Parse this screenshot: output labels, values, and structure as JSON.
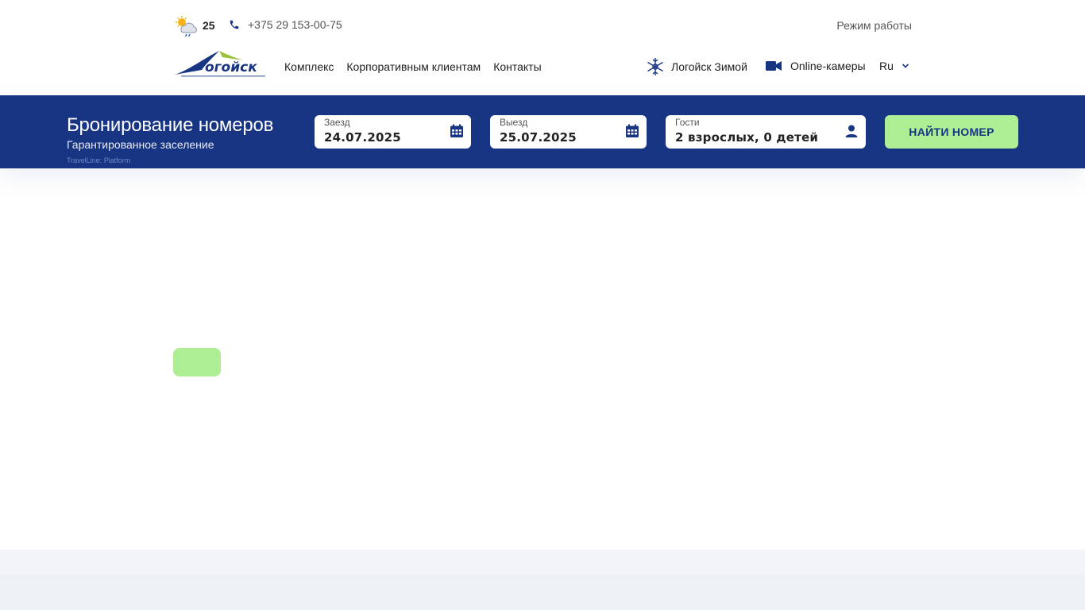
{
  "header": {
    "temperature": "25",
    "weather_icon": "partly-cloudy-rain-icon",
    "phone": "+375 29 153-00-75",
    "hours_link": "Режим работы",
    "nav": [
      {
        "label": "Комплекс"
      },
      {
        "label": "Корпоративным клиентам"
      },
      {
        "label": "Контакты"
      }
    ],
    "winter_link": "Логойск Зимой",
    "cameras_link": "Online-камеры",
    "language": "Ru"
  },
  "booking": {
    "title": "Бронирование номеров",
    "subtitle": "Гарантированное заселение",
    "platform": "TravelLine: Platform",
    "checkin": {
      "label": "Заезд",
      "value": "24.07.2025"
    },
    "checkout": {
      "label": "Выезд",
      "value": "25.07.2025"
    },
    "guests": {
      "label": "Гости",
      "value": "2 взрослых, 0 детей"
    },
    "search_button": "НАЙТИ НОМЕР"
  },
  "colors": {
    "brand_blue": "#183584",
    "accent_green": "#aeee94"
  }
}
